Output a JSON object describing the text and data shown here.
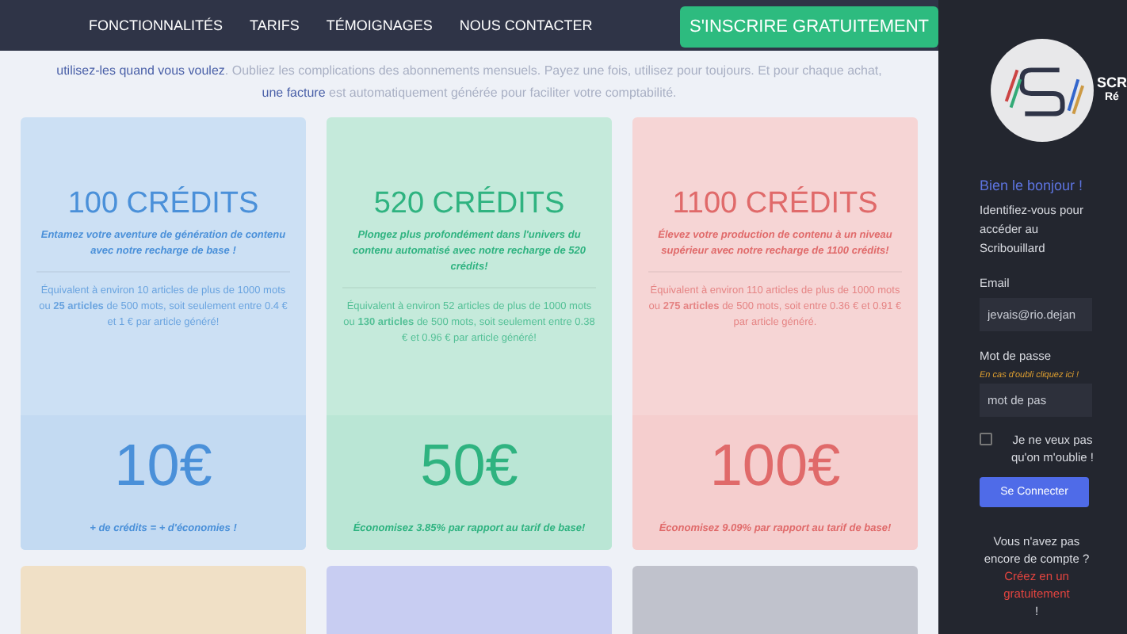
{
  "nav": {
    "links": [
      "FONCTIONNALITÉS",
      "TARIFS",
      "TÉMOIGNAGES",
      "NOUS CONTACTER"
    ],
    "cta": "S'INSCRIRE GRATUITEMENT"
  },
  "intro": "**utilisez-les quand vous voulez**. Oubliez les complications des abonnements mensuels. Payez une fois, utilisez pour toujours. Et pour chaque achat, **une facture** est automatiquement générée pour faciliter votre comptabilité.",
  "plans": [
    {
      "title": "100 CRÉDITS",
      "tagline": "Entamez votre aventure de génération de contenu avec notre recharge de base !",
      "description": "Équivalent à environ 10 articles de plus de 1000 mots ou **25 articles** de 500 mots, soit seulement entre 0.4 € et 1 € par article généré!",
      "price": "10€",
      "savings": "+ de crédits = + d'économies !",
      "color": "#4a90d9"
    },
    {
      "title": "520 CRÉDITS",
      "tagline": "Plongez plus profondément dans l'univers du contenu automatisé avec notre recharge de 520 crédits!",
      "description": "Équivalent à environ 52 articles de plus de 1000 mots ou **130 articles** de 500 mots, soit seulement entre 0.38 € et 0.96 € par article généré!",
      "price": "50€",
      "savings": "Économisez 3.85% par rapport au tarif de base!",
      "color": "#2fb380"
    },
    {
      "title": "1100 CRÉDITS",
      "tagline": "Élevez votre production de contenu à un niveau supérieur avec notre recharge de 1100 crédits!",
      "description": "Équivalent à environ 110 articles de plus de 1000 mots ou **275 articles** de 500 mots, soit entre 0.36 € et 0.91 € par article généré.",
      "price": "100€",
      "savings": "Économisez 9.09% par rapport au tarif de base!",
      "color": "#e06a6a"
    }
  ],
  "more_plans": [
    {
      "color": "#f0e0c6"
    },
    {
      "color": "#c8cdf2"
    },
    {
      "color": "#c0c2cc"
    }
  ],
  "sidebar": {
    "brand": "SCR",
    "brand_sub": "Ré",
    "greeting": "Bien le bonjour !",
    "subtitle": "Identifiez-vous pour accéder au Scribouillard",
    "email_label": "Email",
    "email_value": "jevais@rio.dejan",
    "password_label": "Mot de passe",
    "forgot": "En cas d'oubli cliquez ici !",
    "password_placeholder": "mot de pas",
    "remember": {
      "label": "Je ne veux pas qu'on m'oublie !",
      "checked": false
    },
    "login": "Se Connecter",
    "no_account": "Vous n'avez pas encore de compte ?",
    "signup_link": "Créez en un gratuitement",
    "signup_end": "!"
  }
}
